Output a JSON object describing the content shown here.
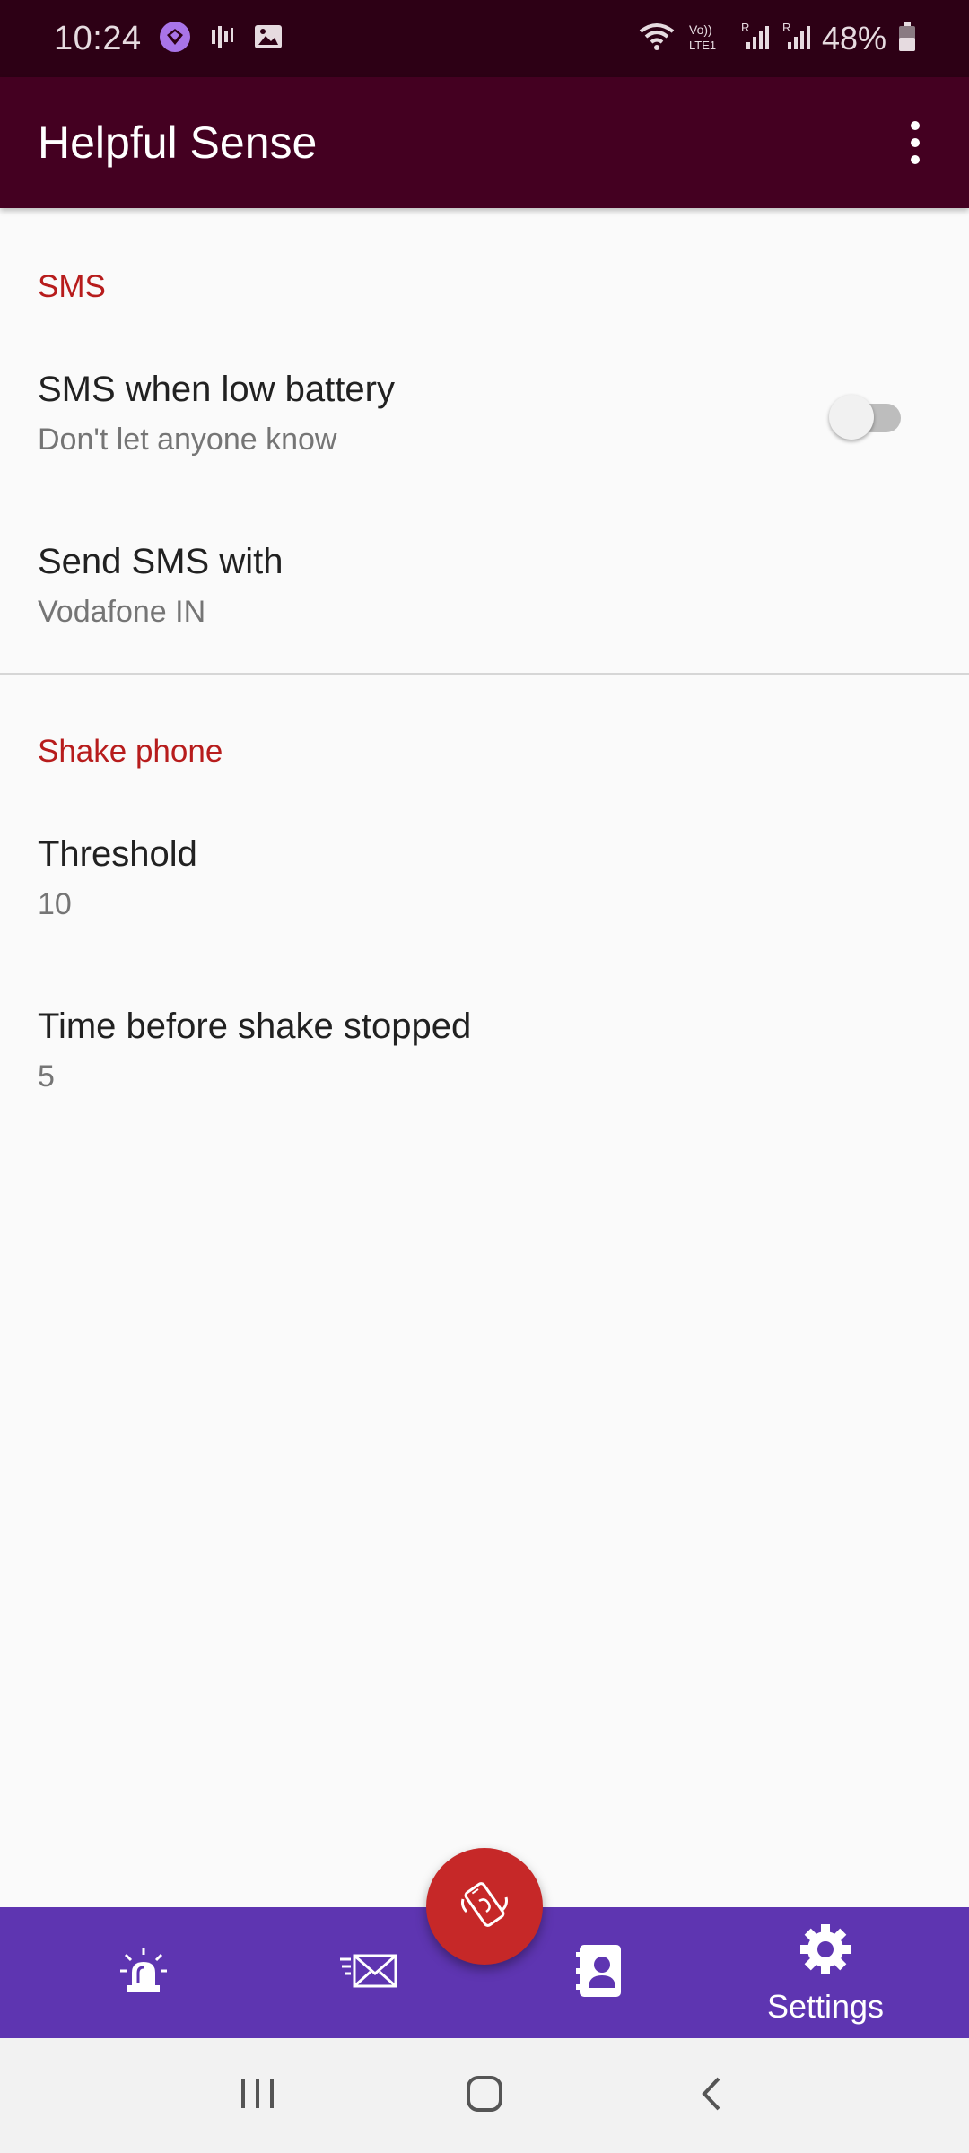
{
  "status_bar": {
    "time": "10:24",
    "battery_percent": "48%",
    "icons": [
      "vpn-icon",
      "audio-icon",
      "image-icon",
      "wifi-icon",
      "volte-icon",
      "signal-1-icon",
      "signal-2-icon",
      "battery-icon"
    ]
  },
  "app_bar": {
    "title": "Helpful Sense",
    "menu_icon": "overflow-menu-icon"
  },
  "sections": {
    "sms": {
      "header": "SMS",
      "low_battery": {
        "title": "SMS when low battery",
        "summary": "Don't let anyone know",
        "enabled": false
      },
      "send_with": {
        "title": "Send SMS with",
        "summary": "Vodafone IN"
      }
    },
    "shake": {
      "header": "Shake phone",
      "threshold": {
        "title": "Threshold",
        "summary": "10"
      },
      "time_before_stop": {
        "title": "Time before shake stopped",
        "summary": "5"
      }
    }
  },
  "bottom_nav": {
    "items": [
      {
        "icon": "alarm-siren-icon",
        "label": ""
      },
      {
        "icon": "send-mail-icon",
        "label": ""
      },
      {
        "icon": "contacts-icon",
        "label": ""
      },
      {
        "icon": "gear-icon",
        "label": "Settings"
      }
    ],
    "selected": "Settings",
    "fab_icon": "shake-phone-icon"
  },
  "colors": {
    "status_bar": "#2d0015",
    "app_bar": "#440021",
    "accent": "#b71c1c",
    "bottom_nav": "#5e35b1",
    "fab": "#c62828"
  }
}
